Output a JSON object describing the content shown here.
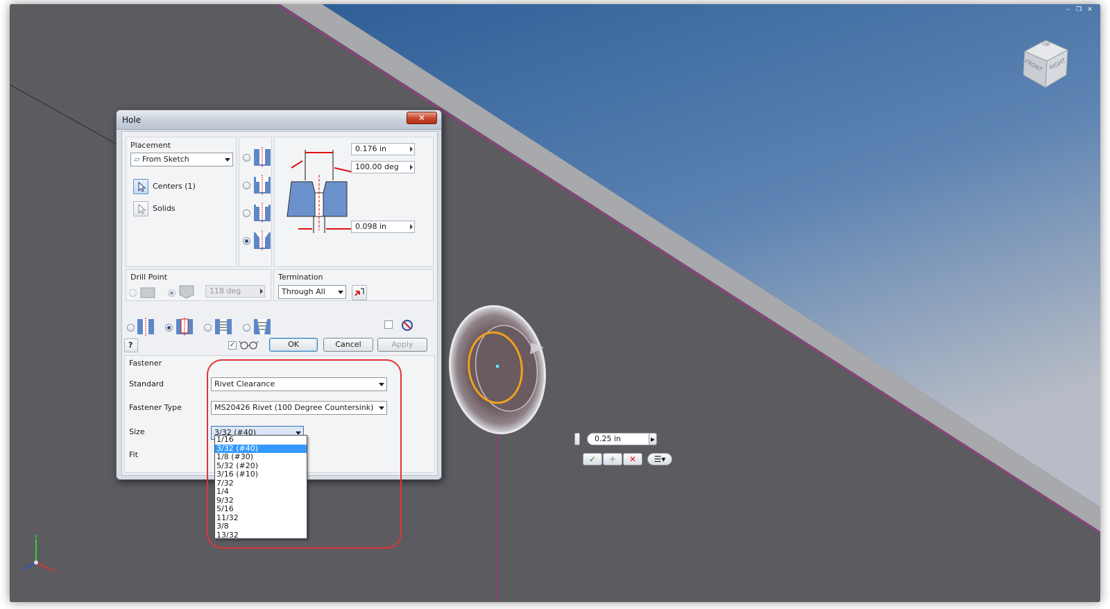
{
  "colors": {
    "viewport_bg": "#5b5b60",
    "sky_top": "#2f5f97",
    "sky_bottom": "#a9b4c4",
    "edge_magenta": "#d01fa0",
    "highlight_red": "#e23434",
    "selection_blue": "#3399ff"
  },
  "viewcube": {
    "top": "TOP",
    "front": "FRONT",
    "right": "RIGHT"
  },
  "triad": {
    "y": "Y",
    "x": "X"
  },
  "dialog": {
    "title": "Hole",
    "close": "✕",
    "placement": {
      "label": "Placement",
      "method": "From Sketch",
      "centers": "Centers (1)",
      "solids": "Solids"
    },
    "dimensions": {
      "diameter": "0.176 in",
      "angle": "100.00 deg",
      "hole_diameter": "0.098 in"
    },
    "drill_point": {
      "label": "Drill Point",
      "angle": "118 deg"
    },
    "termination": {
      "label": "Termination",
      "value": "Through All"
    },
    "buttons": {
      "ok": "OK",
      "cancel": "Cancel",
      "apply": "Apply",
      "help": "?"
    },
    "fastener": {
      "label": "Fastener",
      "standard_label": "Standard",
      "standard_value": "Rivet Clearance",
      "type_label": "Fastener Type",
      "type_value": "MS20426 Rivet (100 Degree Countersink)",
      "size_label": "Size",
      "size_value": "3/32 (#40)",
      "fit_label": "Fit",
      "size_options": [
        "1/16",
        "3/32 (#40)",
        "1/8 (#30)",
        "5/32 (#20)",
        "3/16 (#10)",
        "7/32",
        "1/4",
        "9/32",
        "5/16",
        "11/32",
        "3/8",
        "13/32"
      ],
      "size_selected_index": 1
    }
  },
  "mini_toolbar": {
    "value": "0.25 in"
  }
}
